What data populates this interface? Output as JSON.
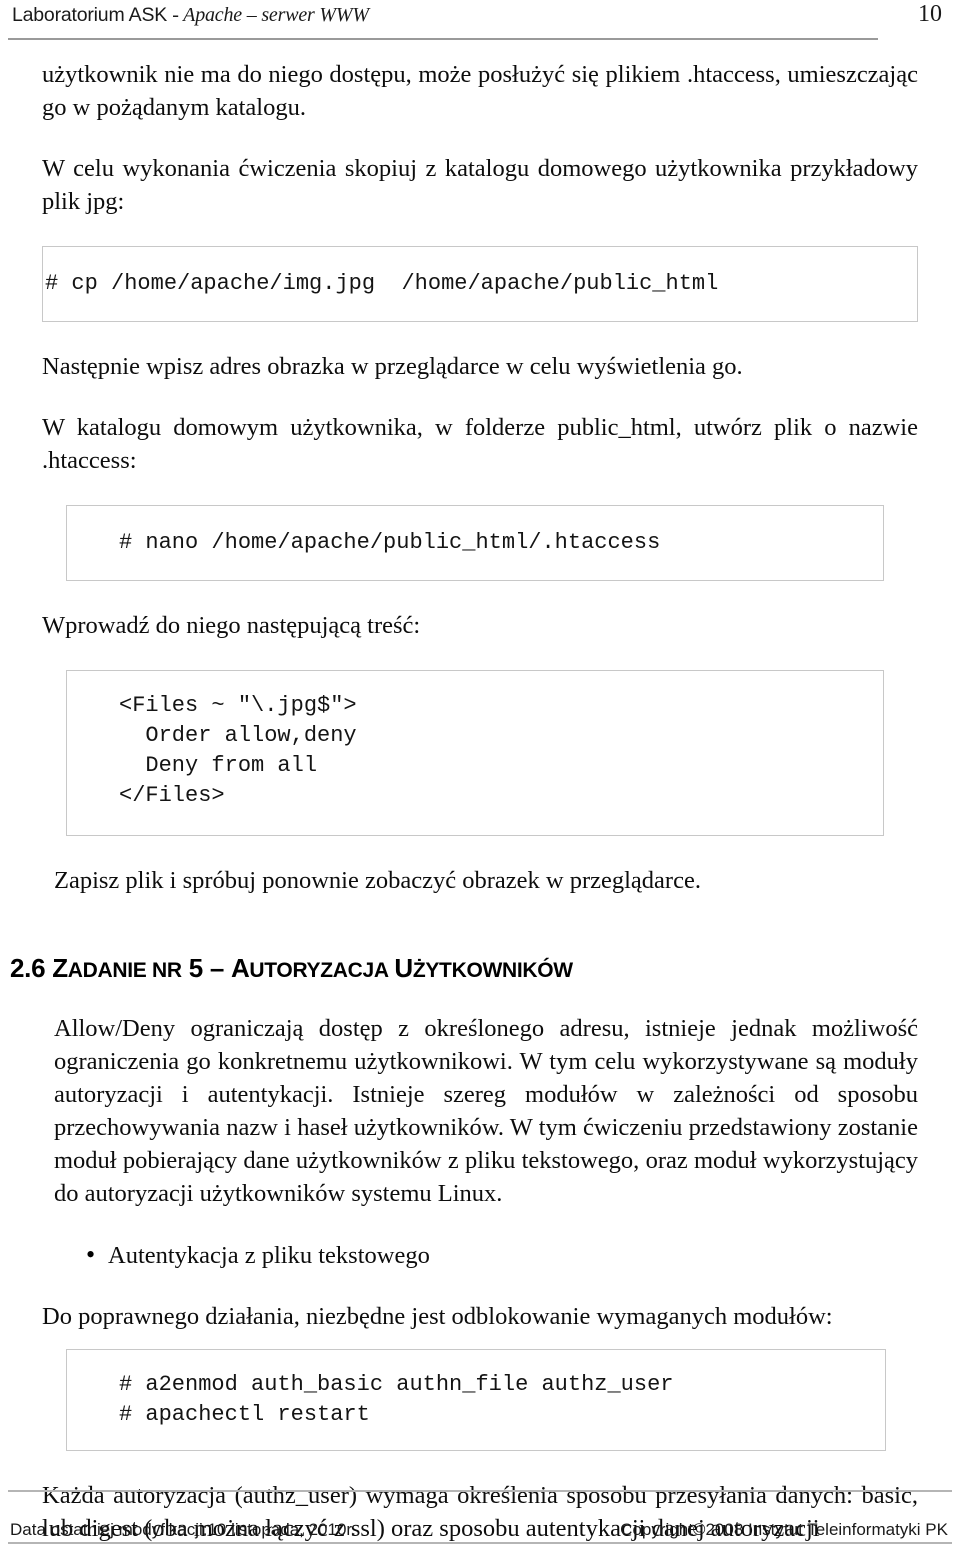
{
  "header": {
    "title_plain": "Laboratorium ASK",
    "title_italic": "- Apache – serwer WWW",
    "page_number": "10"
  },
  "content": {
    "para1": "użytkownik nie ma do niego dostępu, może posłużyć się plikiem .htaccess, umieszczając go w pożądanym katalogu.",
    "para2": "W celu wykonania ćwiczenia skopiuj z katalogu domowego użytkownika przykładowy plik jpg:",
    "code1": "# cp /home/apache/img.jpg  /home/apache/public_html",
    "para3": "Następnie wpisz adres obrazka w przeglądarce w celu wyświetlenia go.",
    "para4": "W katalogu domowym użytkownika, w folderze public_html, utwórz plik o nazwie .htaccess:",
    "code2": "# nano /home/apache/public_html/.htaccess",
    "para5": "Wprowadź do niego następującą treść:",
    "code3": "<Files ~ \"\\.jpg$\">\n  Order allow,deny\n  Deny from all\n</Files>",
    "para6": "Zapisz plik i spróbuj ponownie zobaczyć obrazek w przeglądarce.",
    "heading": {
      "number": "2.6",
      "word1_cap": "Z",
      "word1_rest": "ADANIE",
      "word2": "NR",
      "number2": "5",
      "dash": "–",
      "word3_cap": "A",
      "word3_rest": "UTORYZACJA",
      "word4_cap": "U",
      "word4_rest": "ŻYTKOWNIKÓW",
      "full_text": "2.6 ZADANIE NR 5 – AUTORYZACJA UŻYTKOWNIKÓW"
    },
    "para7": "Allow/Deny ograniczają dostęp z określonego adresu, istnieje jednak możliwość ograniczenia go konkretnemu użytkownikowi. W tym celu wykorzystywane są moduły autoryzacji i autentykacji. Istnieje szereg modułów w zależności od sposobu przechowywania nazw i haseł użytkowników. W tym ćwiczeniu przedstawiony zostanie moduł pobierający dane użytkowników z pliku tekstowego, oraz moduł wykorzystujący do autoryzacji użytkowników systemu Linux.",
    "bullet1": "Autentykacja z pliku tekstowego",
    "bullet_glyph": "•",
    "para8": "Do poprawnego działania, niezbędne jest odblokowanie wymaganych modułów:",
    "code4": "# a2enmod auth_basic authn_file authz_user\n# apachectl restart",
    "para9": "Każda autoryzacja (authz_user) wymaga określenia sposobu przesyłania danych: basic, lub digest (oba można łączyć z ssl) oraz sposobu autentykacji danej autoryzacji"
  },
  "footer": {
    "left": "Data ostatniej modyfikacji:10 listopada, 2010r.",
    "right": "Copyright©2008 Instytut Teleinformatyki PK"
  }
}
